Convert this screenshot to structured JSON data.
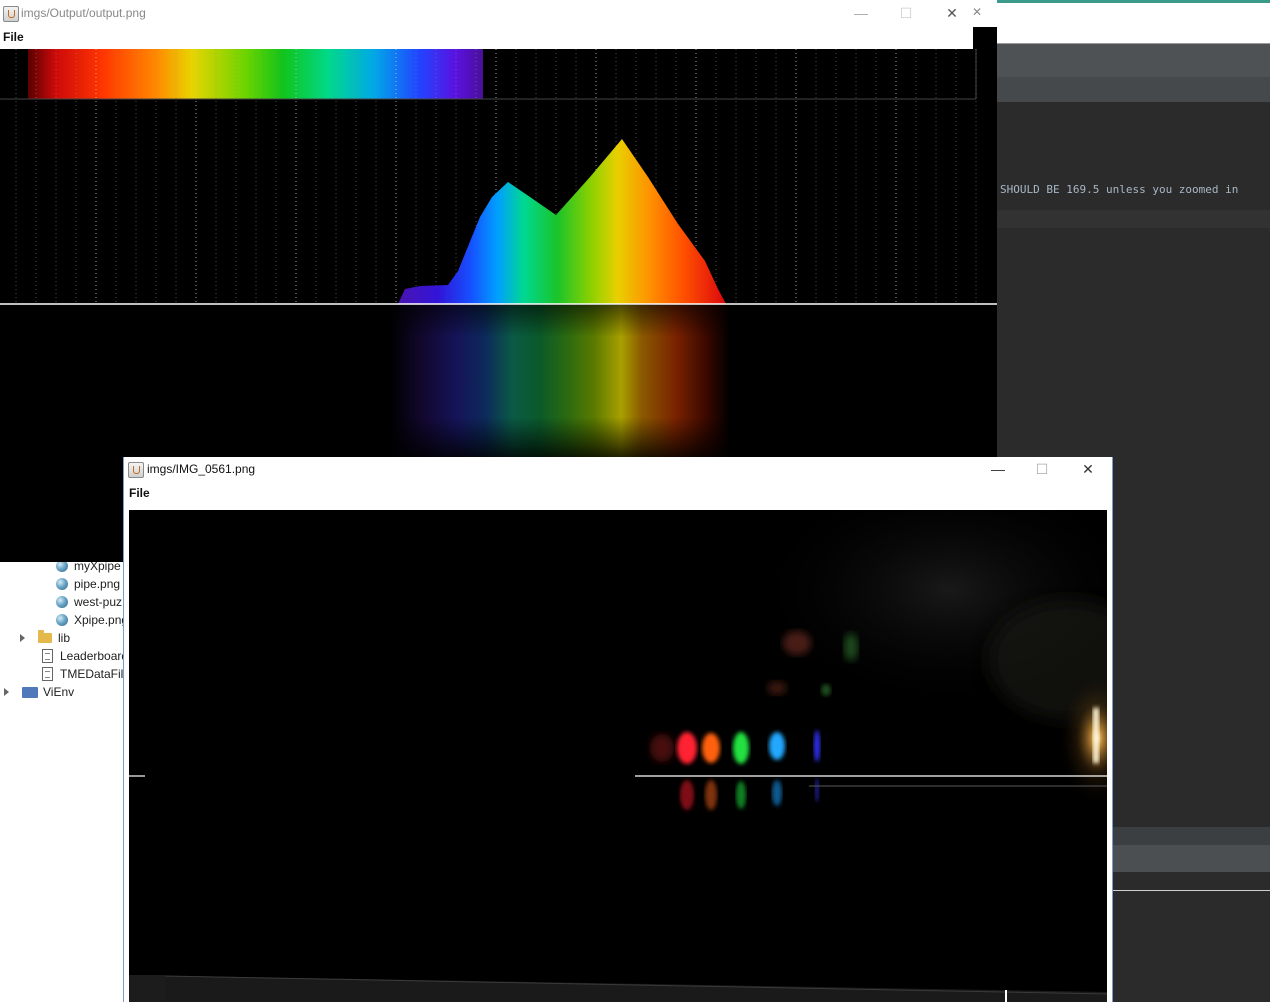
{
  "ide": {
    "code_comment": "SHOULD BE 169.5 unless you zoomed in",
    "tree_items": [
      {
        "label": "myXpipe",
        "icon": "image-file-icon"
      },
      {
        "label": "pipe.png",
        "icon": "image-file-icon"
      },
      {
        "label": "west-puz",
        "icon": "image-file-icon"
      },
      {
        "label": "Xpipe.png",
        "icon": "image-file-icon"
      },
      {
        "label": "lib",
        "icon": "folder-icon"
      },
      {
        "label": "Leaderboard",
        "icon": "text-file-icon"
      },
      {
        "label": "TMEDataFile",
        "icon": "text-file-icon"
      },
      {
        "label": "ViEnv",
        "icon": "project-icon"
      }
    ]
  },
  "output_window": {
    "title": "imgs/Output/output.png",
    "menu_file": "File",
    "controls": {
      "minimize": "—",
      "maximize": "☐",
      "close": "✕"
    }
  },
  "image_window": {
    "title": "imgs/IMG_0561.png",
    "menu_file": "File",
    "controls": {
      "minimize": "—",
      "maximize": "☐",
      "close": "✕"
    }
  },
  "colors": {
    "background": "#000000",
    "ide_editor": "#2b2b2b",
    "accent_top": "#3c9a8a"
  }
}
